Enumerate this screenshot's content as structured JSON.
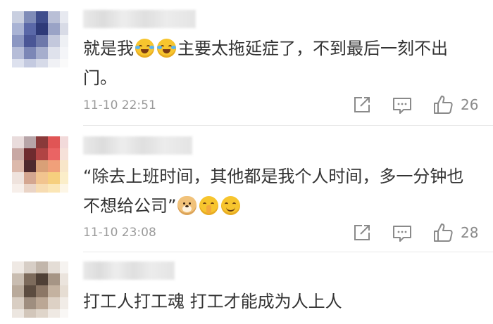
{
  "comments": [
    {
      "text_parts": [
        "就是我",
        "主要太拖延症了，不到最后一刻不出门。"
      ],
      "emoji_names": [
        "laughing-crying-emoji",
        "laughing-crying-emoji"
      ],
      "timestamp": "11-10 22:51",
      "likes": "26",
      "icons": {
        "share": "share-icon",
        "reply": "reply-icon",
        "like": "thumbs-up-icon"
      }
    },
    {
      "text": "“除去上班时间，其他都是我个人时间，多一分钟也不想给公司”",
      "emoji_names": [
        "doge-emoji",
        "shush-emoji",
        "grin-emoji"
      ],
      "timestamp": "11-10 23:08",
      "likes": "28",
      "icons": {
        "share": "share-icon",
        "reply": "reply-icon",
        "like": "thumbs-up-icon"
      }
    },
    {
      "text": "打工人打工魂 打工才能成为人上人"
    }
  ],
  "colors": {
    "text": "#333333",
    "meta": "#9a9a9a",
    "icon": "#8a8a8a",
    "divider": "#e8e8e8",
    "background": "#ffffff"
  }
}
